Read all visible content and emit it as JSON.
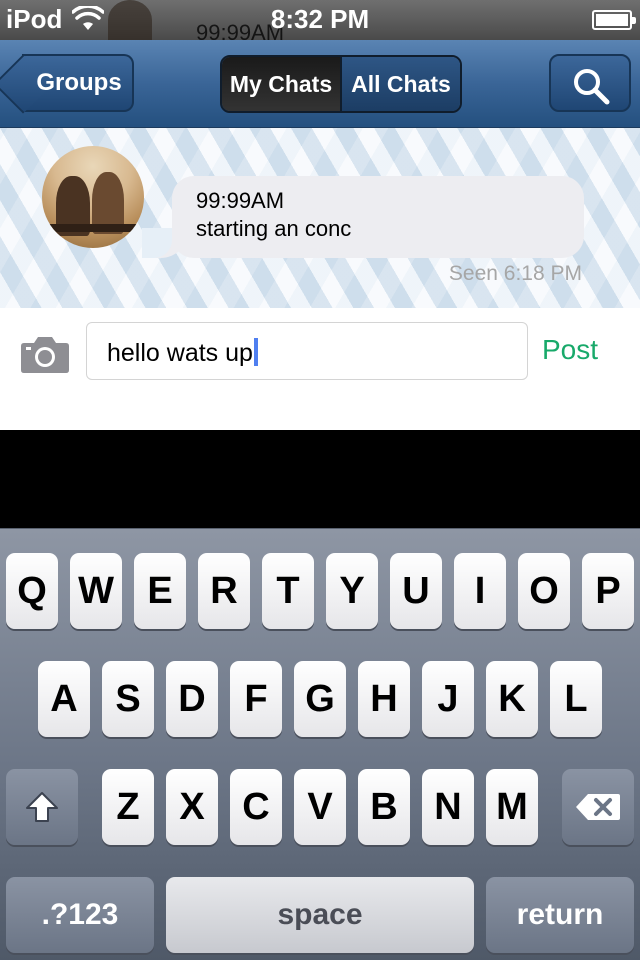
{
  "status_bar": {
    "carrier": "iPod",
    "time": "8:32 PM",
    "overlap_text": "99:99AM"
  },
  "nav_bar": {
    "back_label": "Groups",
    "segments": [
      {
        "label": "My Chats",
        "selected": true
      },
      {
        "label": "All Chats",
        "selected": false
      }
    ],
    "search_icon": "search-icon"
  },
  "message": {
    "time": "99:99AM",
    "text": "starting an conc",
    "seen": "Seen 6:18 PM"
  },
  "composer": {
    "camera_icon": "camera-icon",
    "input_value": "hello wats up",
    "post_label": "Post",
    "post_color": "#18a96a"
  },
  "keyboard": {
    "row1": [
      "Q",
      "W",
      "E",
      "R",
      "T",
      "Y",
      "U",
      "I",
      "O",
      "P"
    ],
    "row2": [
      "A",
      "S",
      "D",
      "F",
      "G",
      "H",
      "J",
      "K",
      "L"
    ],
    "row3": [
      "Z",
      "X",
      "C",
      "V",
      "B",
      "N",
      "M"
    ],
    "numbers_label": ".?123",
    "space_label": "space",
    "return_label": "return"
  }
}
